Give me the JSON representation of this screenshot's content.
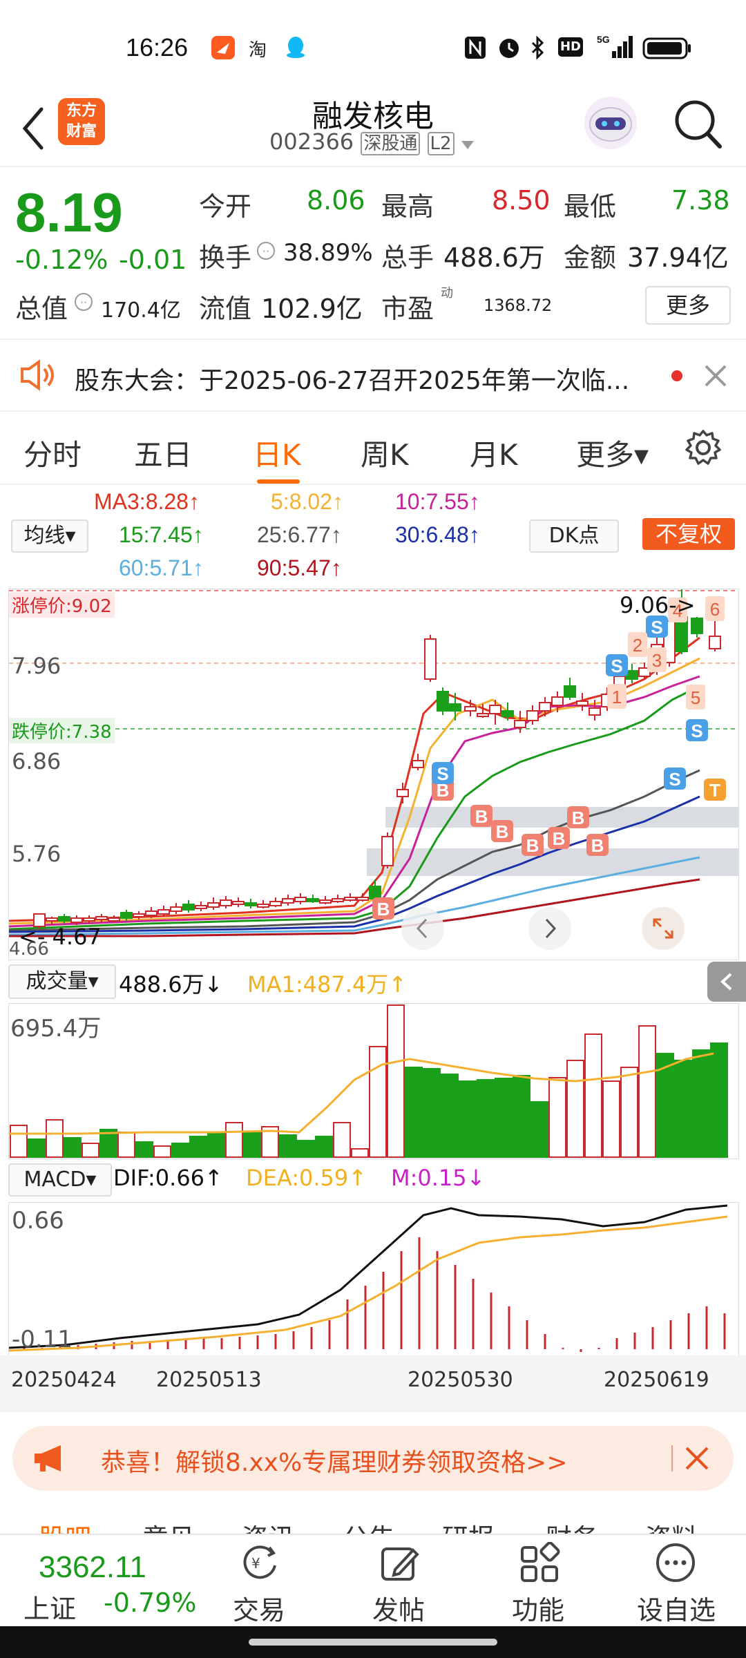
{
  "status_bar": {
    "time": "16:26",
    "app_icons": [
      "feishu-icon",
      "taobao-icon",
      "qq-icon"
    ],
    "right_icons": [
      "nfc-icon",
      "alarm-icon",
      "bluetooth-icon",
      "hd-icon",
      "signal-5g-icon",
      "battery-icon"
    ],
    "hd": "HD",
    "network": "5G",
    "taobao": "淘"
  },
  "header": {
    "logo_line1": "东方",
    "logo_line2": "财富",
    "stock_name": "融发核电",
    "stock_code": "002366",
    "market_tag": "深股通",
    "level_tag": "L2"
  },
  "quote": {
    "price": "8.19",
    "change_pct": "-0.12%",
    "change": "-0.01",
    "open_label": "今开",
    "open": "8.06",
    "high_label": "最高",
    "high": "8.50",
    "low_label": "最低",
    "low": "7.38",
    "turnover_label": "换手",
    "turnover": "38.89%",
    "volume_label": "总手",
    "volume": "488.6万",
    "amount_label": "金额",
    "amount": "37.94亿",
    "total_value_label": "总值",
    "total_value": "170.4亿",
    "float_value_label": "流值",
    "float_value": "102.9亿",
    "pe_label": "市盈",
    "pe_sup": "动",
    "pe": "1368.72",
    "more_button": "更多"
  },
  "notice": {
    "text": "股东大会：于2025-06-27召开2025年第一次临..."
  },
  "tabs": [
    {
      "label": "分时"
    },
    {
      "label": "五日"
    },
    {
      "label": "日K",
      "active": true
    },
    {
      "label": "周K"
    },
    {
      "label": "月K"
    },
    {
      "label": "更多▾"
    }
  ],
  "ma": {
    "selector": "均线▾",
    "ma3": "MA3:8.28↑",
    "ma5": "5:8.02↑",
    "ma10": "10:7.55↑",
    "ma15": "15:7.45↑",
    "ma25": "25:6.77↑",
    "ma30": "30:6.48↑",
    "ma60": "60:5.71↑",
    "ma90": "90:5.47↑",
    "dk_button": "DK点",
    "fq_button": "不复权"
  },
  "colors": {
    "ma3": "#e0301e",
    "ma5": "#f5b030",
    "ma10": "#c8209a",
    "ma15": "#1a9a1a",
    "ma25": "#555555",
    "ma30": "#1a2fa8",
    "ma60": "#5aaee0",
    "ma90": "#b0141e",
    "up": "#c8282e",
    "down": "#1aa01a",
    "accent": "#ff6a00"
  },
  "kline": {
    "limit_up_label": "涨停价:9.02",
    "limit_down_label": "跌停价:7.38",
    "y_labels": [
      "7.96",
      "6.86",
      "5.76"
    ],
    "high_label": "9.06->",
    "low_label": "<- 4.67",
    "bottom_label": "4.66",
    "marker_labels": [
      "1",
      "2",
      "3",
      "4",
      "5",
      "6"
    ]
  },
  "volume": {
    "selector": "成交量▾",
    "value": "488.6万↓",
    "ma1": "MA1:487.4万↑",
    "y_label": "695.4万"
  },
  "macd": {
    "selector": "MACD▾",
    "dif": "DIF:0.66↑",
    "dea": "DEA:0.59↑",
    "m": "M:0.15↓",
    "y_top": "0.66",
    "y_bottom": "-0.11"
  },
  "dates": [
    "20250424",
    "20250513",
    "20250530",
    "20250619"
  ],
  "promo": {
    "text": "恭喜！解锁8.xx%专属理财券领取资格>>"
  },
  "bottom_tabs_partial": [
    "股吧",
    "意见",
    "资讯",
    "公告",
    "研报",
    "财务",
    "资料"
  ],
  "bottom_nav": {
    "index_value": "3362.11",
    "index_name": "上证",
    "index_change": "-0.79%",
    "items": [
      {
        "label": "交易",
        "icon": "yen-trade-icon"
      },
      {
        "label": "发帖",
        "icon": "edit-post-icon"
      },
      {
        "label": "功能",
        "icon": "grid-function-icon"
      },
      {
        "label": "设自选",
        "icon": "more-dots-icon"
      }
    ]
  }
}
